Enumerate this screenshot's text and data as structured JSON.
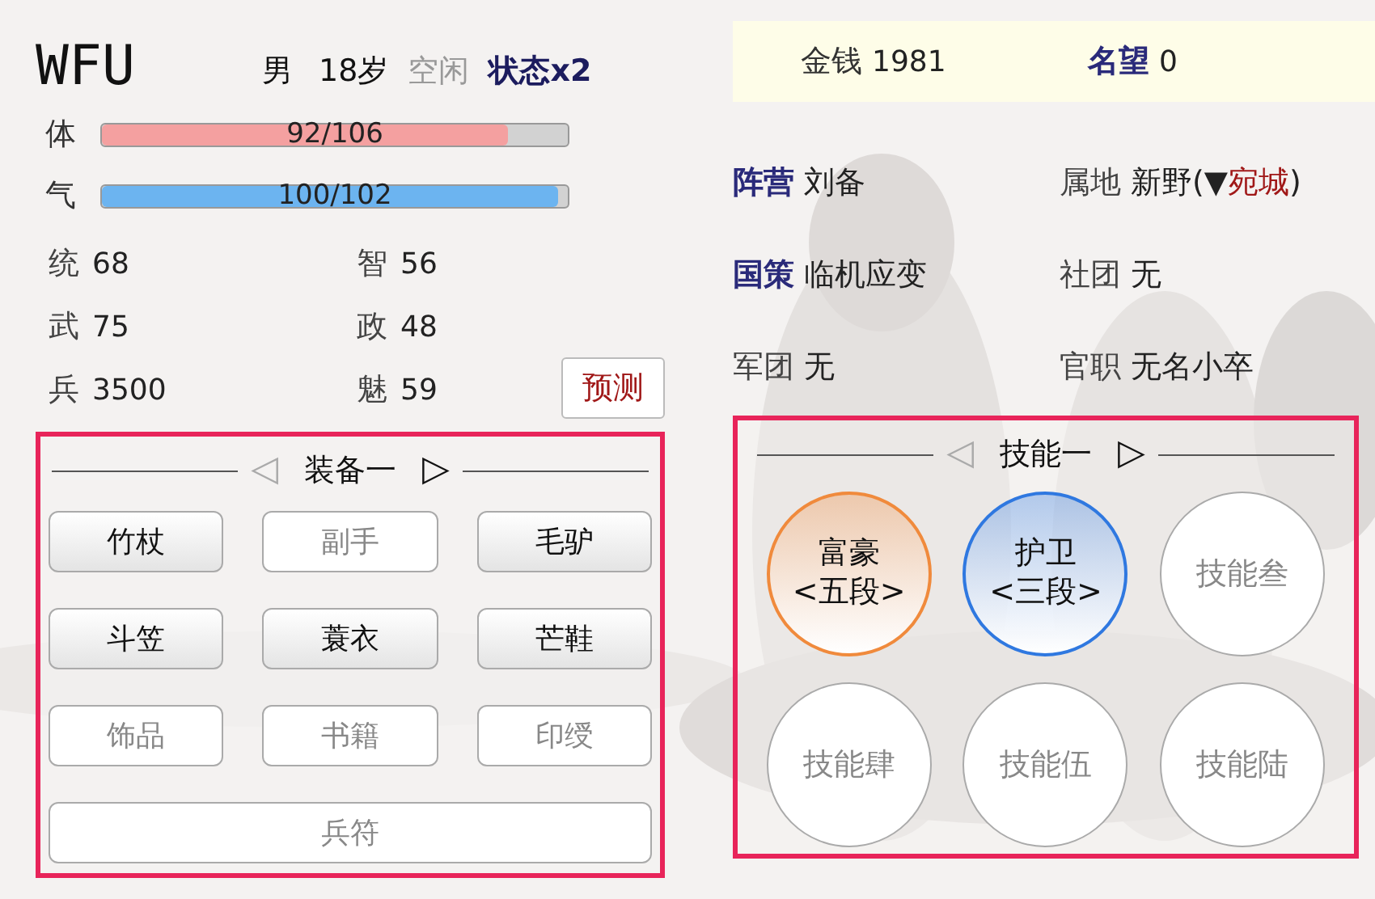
{
  "profile": {
    "name": "WFU",
    "gender": "男",
    "age": "18岁",
    "status": "空闲",
    "buff": "状态x2"
  },
  "bars": [
    {
      "label": "体",
      "reading": "92/106",
      "level": 0.87,
      "color": "#f4a0a0"
    },
    {
      "label": "气",
      "reading": "100/102",
      "level": 0.98,
      "color": "#6cb4f0"
    }
  ],
  "stats": [
    {
      "label": "统",
      "value": "68"
    },
    {
      "label": "智",
      "value": "56"
    },
    {
      "label": "武",
      "value": "75"
    },
    {
      "label": "政",
      "value": "48"
    },
    {
      "label": "兵",
      "value": "3500"
    },
    {
      "label": "魅",
      "value": "59"
    }
  ],
  "predict_button": "预测",
  "resources": [
    {
      "label": "金钱",
      "value": "1981",
      "highlight": false
    },
    {
      "label": "名望",
      "value": "0",
      "highlight": true
    }
  ],
  "info": [
    {
      "label": "阵营",
      "value": "刘备",
      "highlight": true
    },
    {
      "label": "属地",
      "value": "新野(▼",
      "link": "宛城",
      "suffix": ")",
      "highlight": false
    },
    {
      "label": "国策",
      "value": "临机应变",
      "highlight": true
    },
    {
      "label": "社团",
      "value": "无",
      "highlight": false
    },
    {
      "label": "军团",
      "value": "无",
      "highlight": false
    },
    {
      "label": "官职",
      "value": "无名小卒",
      "highlight": false
    }
  ],
  "equipment": {
    "prev": "◁",
    "prev_enabled": false,
    "title": "装备一",
    "next": "▷",
    "next_enabled": true,
    "slots": [
      {
        "label": "竹杖",
        "equipped": true,
        "kind": "normal"
      },
      {
        "label": "副手",
        "equipped": false,
        "kind": "normal"
      },
      {
        "label": "毛驴",
        "equipped": true,
        "kind": "normal"
      },
      {
        "label": "斗笠",
        "equipped": true,
        "kind": "normal"
      },
      {
        "label": "蓑衣",
        "equipped": true,
        "kind": "normal"
      },
      {
        "label": "芒鞋",
        "equipped": true,
        "kind": "normal"
      },
      {
        "label": "饰品",
        "equipped": false,
        "kind": "normal"
      },
      {
        "label": "书籍",
        "equipped": false,
        "kind": "normal"
      },
      {
        "label": "印绶",
        "equipped": false,
        "kind": "normal"
      },
      {
        "label": "兵符",
        "equipped": false,
        "kind": "wide"
      }
    ]
  },
  "skills": {
    "prev": "◁",
    "prev_enabled": false,
    "title": "技能一",
    "next": "▷",
    "next_enabled": true,
    "items": [
      {
        "kind": "learned",
        "name": "富豪",
        "grade": "<五段>",
        "color": "#f08a3c"
      },
      {
        "kind": "learned",
        "name": "护卫",
        "grade": "<三段>",
        "color": "#2f78e0"
      },
      {
        "kind": "empty",
        "name": "技能叁"
      },
      {
        "kind": "empty",
        "name": "技能肆"
      },
      {
        "kind": "empty",
        "name": "技能伍"
      },
      {
        "kind": "empty",
        "name": "技能陆"
      }
    ]
  }
}
